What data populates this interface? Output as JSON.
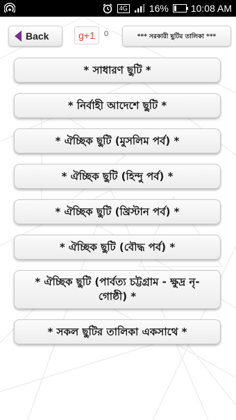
{
  "status_bar": {
    "network": "4G",
    "battery": "16%",
    "battery_level": 0.16,
    "time": "10:08 AM"
  },
  "header": {
    "back_label": "Back",
    "gplus_label": "g+1",
    "gplus_count": "0",
    "list_button_label": "*** সরকারী ছুটির তালিকা ***"
  },
  "menu": {
    "items": [
      {
        "label": "* সাধারণ ছুটি *"
      },
      {
        "label": "* নির্বাহী আদেশে ছুটি *"
      },
      {
        "label": "* ঐচ্ছিক ছুটি (মুসলিম পর্ব) *"
      },
      {
        "label": "* ঐচ্ছিক ছুটি (হিন্দু পর্ব) *"
      },
      {
        "label": "* ঐচ্ছিক ছুটি (খ্রিস্টান পর্ব) *"
      },
      {
        "label": "* ঐচ্ছিক ছুটি (বৌদ্ধ পর্ব) *"
      },
      {
        "label": "* ঐচ্ছিক ছুটি (পার্বত্য চট্টগ্রাম - ক্ষুদ্র নৃ-গোষ্ঠী) *"
      },
      {
        "label": "* সকল ছুটির তালিকা একসাথে *"
      }
    ]
  }
}
